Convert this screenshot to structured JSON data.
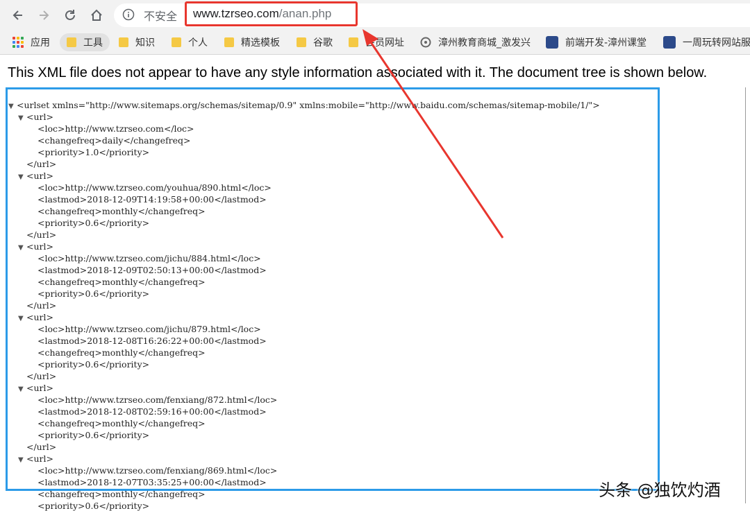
{
  "toolbar": {
    "security_label": "不安全",
    "url_host": "www.tzrseo.com",
    "url_path": "/anan.php"
  },
  "bookmarks": [
    {
      "label": "应用",
      "icon": "apps-icon"
    },
    {
      "label": "工具",
      "icon": "folder-icon"
    },
    {
      "label": "知识",
      "icon": "folder-icon"
    },
    {
      "label": "个人",
      "icon": "folder-icon"
    },
    {
      "label": "精选模板",
      "icon": "folder-icon"
    },
    {
      "label": "谷歌",
      "icon": "folder-icon"
    },
    {
      "label": "会员网址",
      "icon": "folder-icon"
    },
    {
      "label": "漳州教育商城_激发兴",
      "icon": "site-icon"
    },
    {
      "label": "前端开发-漳州课堂",
      "icon": "site-badge-icon"
    },
    {
      "label": "一周玩转网站服",
      "icon": "site-badge-icon"
    }
  ],
  "page": {
    "info_message": "This XML file does not appear to have any style information associated with it. The document tree is shown below."
  },
  "xml": {
    "root_open": "<urlset xmlns=\"http://www.sitemaps.org/schemas/sitemap/0.9\" xmlns:mobile=\"http://www.baidu.com/schemas/sitemap-mobile/1/\">",
    "url_open": "<url>",
    "url_close": "</url>",
    "entries": [
      {
        "loc": "<loc>http://www.tzrseo.com</loc>",
        "lastmod": "",
        "changefreq": "<changefreq>daily</changefreq>",
        "priority": "<priority>1.0</priority>"
      },
      {
        "loc": "<loc>http://www.tzrseo.com/youhua/890.html</loc>",
        "lastmod": "<lastmod>2018-12-09T14:19:58+00:00</lastmod>",
        "changefreq": "<changefreq>monthly</changefreq>",
        "priority": "<priority>0.6</priority>"
      },
      {
        "loc": "<loc>http://www.tzrseo.com/jichu/884.html</loc>",
        "lastmod": "<lastmod>2018-12-09T02:50:13+00:00</lastmod>",
        "changefreq": "<changefreq>monthly</changefreq>",
        "priority": "<priority>0.6</priority>"
      },
      {
        "loc": "<loc>http://www.tzrseo.com/jichu/879.html</loc>",
        "lastmod": "<lastmod>2018-12-08T16:26:22+00:00</lastmod>",
        "changefreq": "<changefreq>monthly</changefreq>",
        "priority": "<priority>0.6</priority>"
      },
      {
        "loc": "<loc>http://www.tzrseo.com/fenxiang/872.html</loc>",
        "lastmod": "<lastmod>2018-12-08T02:59:16+00:00</lastmod>",
        "changefreq": "<changefreq>monthly</changefreq>",
        "priority": "<priority>0.6</priority>"
      },
      {
        "loc": "<loc>http://www.tzrseo.com/fenxiang/869.html</loc>",
        "lastmod": "<lastmod>2018-12-07T03:35:25+00:00</lastmod>",
        "changefreq": "<changefreq>monthly</changefreq>",
        "priority": "<priority>0.6</priority>"
      }
    ]
  },
  "watermark": "头条 @独饮灼酒",
  "colors": {
    "highlight_red": "#e8362e",
    "box_blue": "#2c9be8",
    "xml_tag": "#881280"
  }
}
